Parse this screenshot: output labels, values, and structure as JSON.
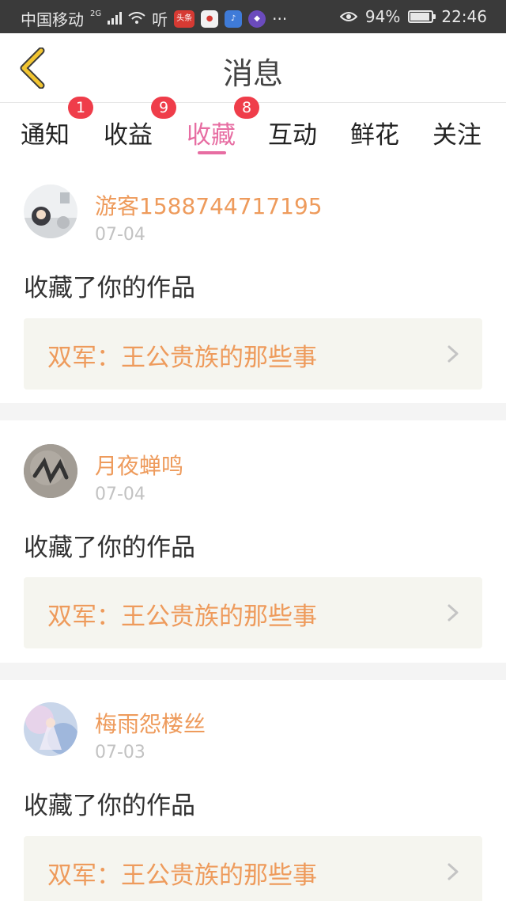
{
  "status_bar": {
    "carrier": "中国移动",
    "network": "2G",
    "listen": "听",
    "news_app": "头条",
    "more": "···",
    "battery": "94%",
    "battery_level": 0.94,
    "time": "22:46"
  },
  "header": {
    "title": "消息"
  },
  "tabs": [
    {
      "label": "通知",
      "badge": "1"
    },
    {
      "label": "收益",
      "badge": "9"
    },
    {
      "label": "收藏",
      "badge": "8",
      "active": true
    },
    {
      "label": "互动"
    },
    {
      "label": "鲜花"
    },
    {
      "label": "关注"
    }
  ],
  "messages": [
    {
      "username": "游客1588744717195",
      "date": "07-04",
      "text": "收藏了你的作品",
      "work": "双军：王公贵族的那些事"
    },
    {
      "username": "月夜蝉鸣",
      "date": "07-04",
      "text": "收藏了你的作品",
      "work": "双军：王公贵族的那些事"
    },
    {
      "username": "梅雨怨楼丝",
      "date": "07-03",
      "text": "收藏了你的作品",
      "work": "双军：王公贵族的那些事"
    }
  ],
  "colors": {
    "accent": "#e76da2",
    "username": "#ee9b5c",
    "badge": "#ef3d4a",
    "work_box": "#f5f5ef"
  }
}
